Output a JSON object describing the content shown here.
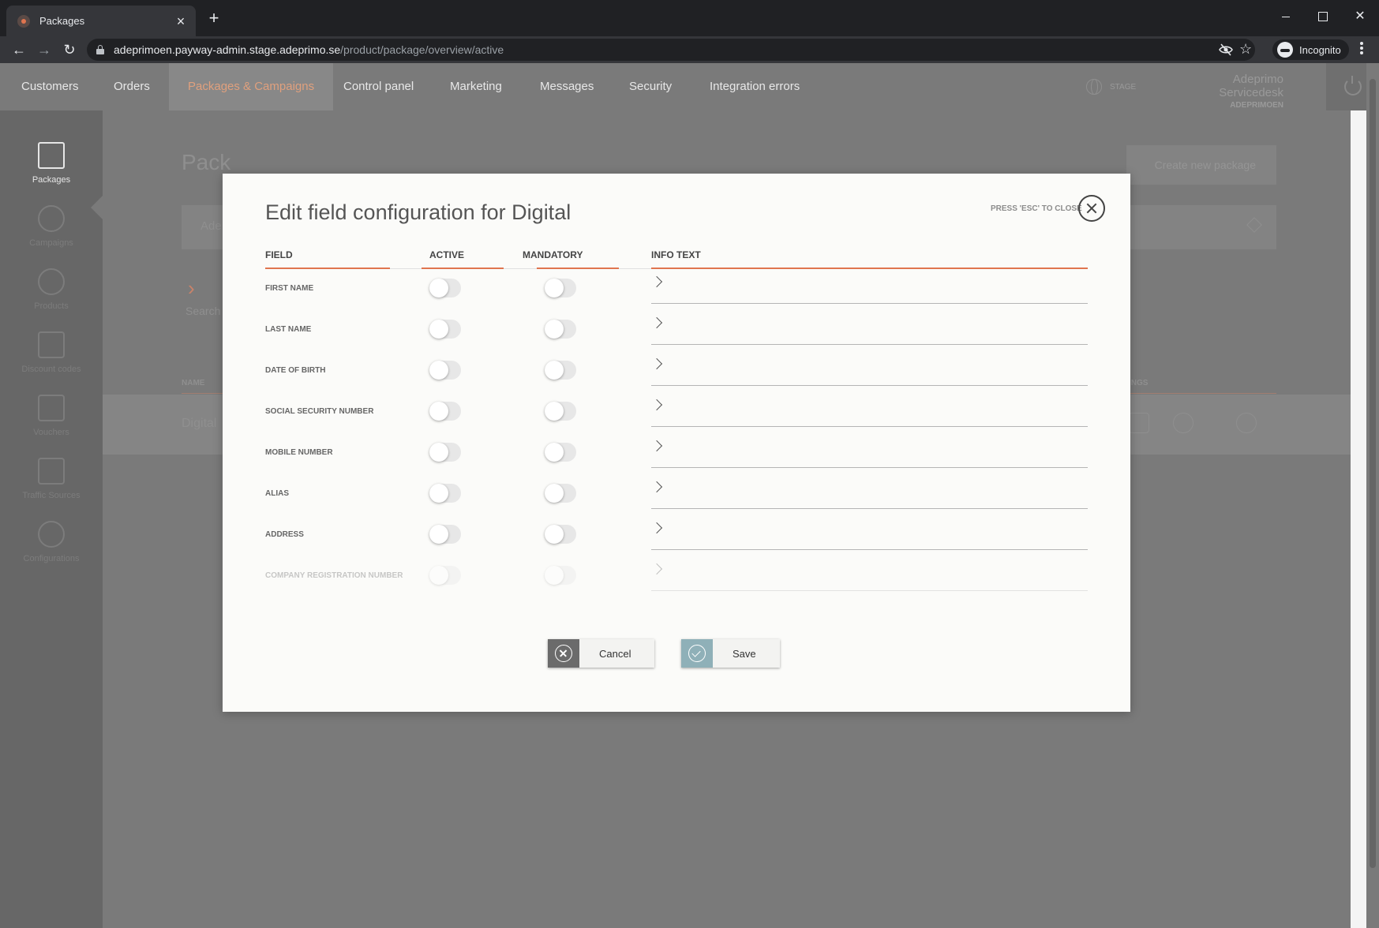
{
  "browser": {
    "tab_title": "Packages",
    "url_host": "adeprimoen.payway-admin.stage.adeprimo.se",
    "url_path": "/product/package/overview/active",
    "incognito_label": "Incognito"
  },
  "topnav": {
    "items": [
      "Customers",
      "Orders",
      "Packages & Campaigns",
      "Control panel",
      "Marketing",
      "Messages",
      "Security",
      "Integration errors"
    ],
    "active": "Packages & Campaigns",
    "env_label": "STAGE",
    "user_name": "Adeprimo Servicedesk",
    "user_org": "ADEPRIMOEN"
  },
  "sidebar": {
    "items": [
      "Packages",
      "Campaigns",
      "Products",
      "Discount codes",
      "Vouchers",
      "Traffic Sources",
      "Configurations"
    ],
    "active": "Packages"
  },
  "background_page": {
    "title_fragment": "Pack",
    "create_button": "Create new package",
    "filter_fragment": "Ade",
    "section_fragment": "Se",
    "search_fragment": "Search",
    "col_name": "NAME",
    "col_settings_fragment": "INGS",
    "row_name": "Digital"
  },
  "modal": {
    "title": "Edit field configuration for Digital",
    "esc_hint": "PRESS 'ESC' TO CLOSE",
    "columns": {
      "field": "FIELD",
      "active": "ACTIVE",
      "mandatory": "MANDATORY",
      "info": "INFO TEXT"
    },
    "rows": [
      {
        "label": "FIRST NAME",
        "active": false,
        "mandatory": false
      },
      {
        "label": "LAST NAME",
        "active": false,
        "mandatory": false
      },
      {
        "label": "DATE OF BIRTH",
        "active": false,
        "mandatory": false
      },
      {
        "label": "SOCIAL SECURITY NUMBER",
        "active": false,
        "mandatory": false
      },
      {
        "label": "MOBILE NUMBER",
        "active": false,
        "mandatory": false
      },
      {
        "label": "ALIAS",
        "active": false,
        "mandatory": false
      },
      {
        "label": "ADDRESS",
        "active": false,
        "mandatory": false
      },
      {
        "label": "COMPANY REGISTRATION NUMBER",
        "active": false,
        "mandatory": false
      }
    ],
    "cancel_label": "Cancel",
    "save_label": "Save"
  }
}
